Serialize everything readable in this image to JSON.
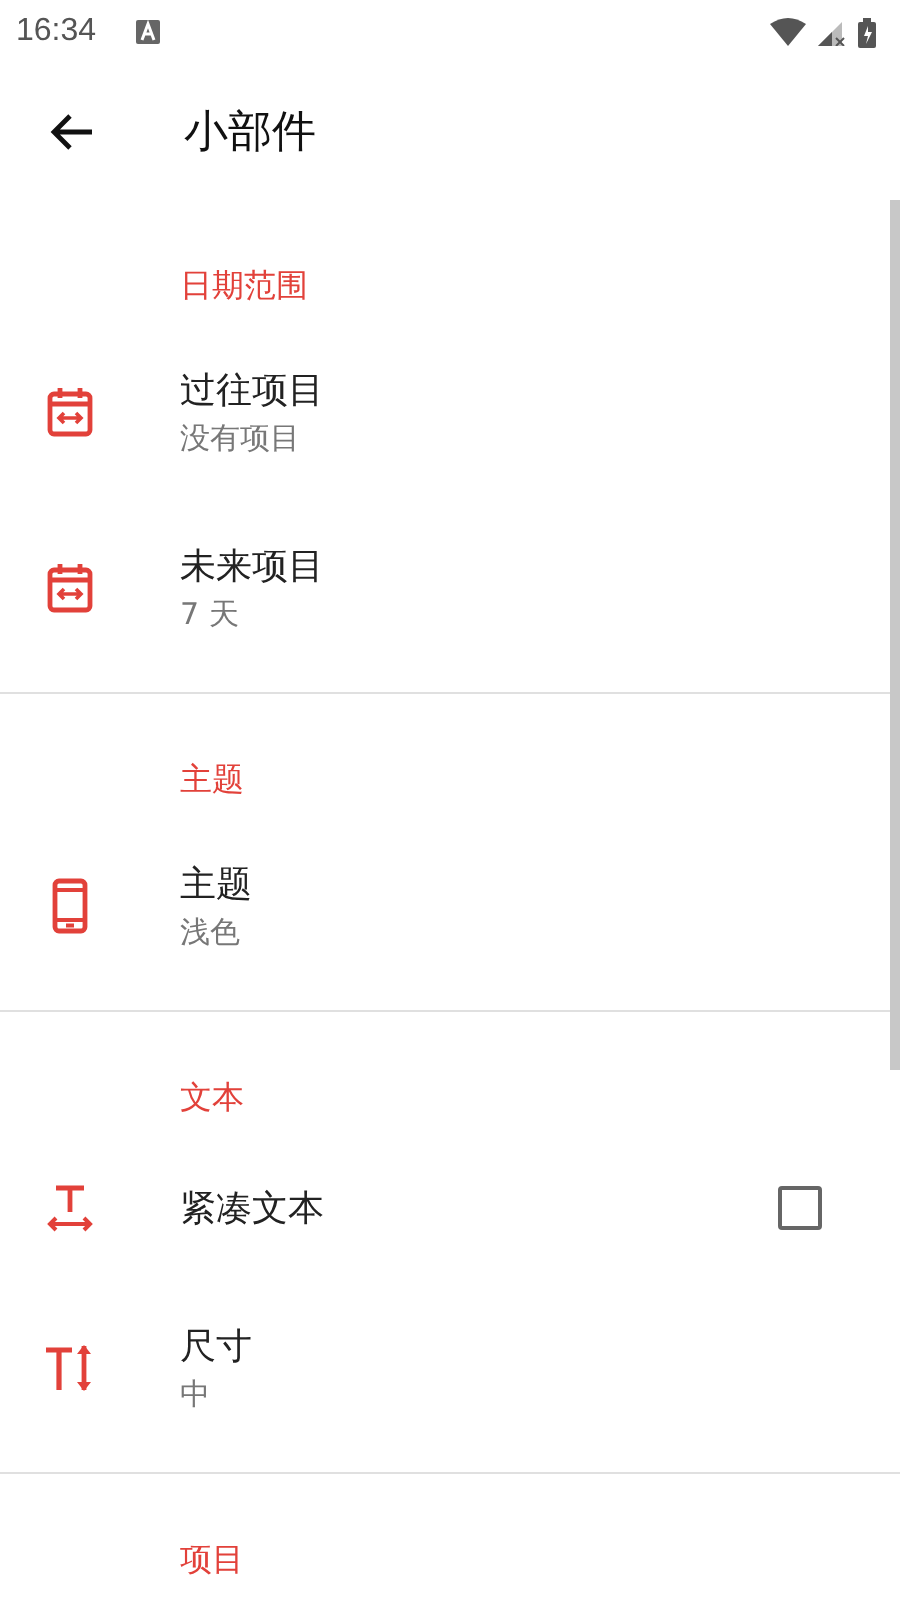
{
  "status_bar": {
    "time": "16:34"
  },
  "toolbar": {
    "title": "小部件"
  },
  "sections": [
    {
      "header": "日期范围",
      "items": [
        {
          "kind": "value",
          "title": "过往项目",
          "summary": "没有项目"
        },
        {
          "kind": "value",
          "title": "未来项目",
          "summary": "7 天"
        }
      ]
    },
    {
      "header": "主题",
      "items": [
        {
          "kind": "value",
          "title": "主题",
          "summary": "浅色"
        }
      ]
    },
    {
      "header": "文本",
      "items": [
        {
          "kind": "checkbox",
          "title": "紧凑文本",
          "checked": false
        },
        {
          "kind": "value",
          "title": "尺寸",
          "summary": "中"
        }
      ]
    },
    {
      "header": "项目"
    }
  ]
}
